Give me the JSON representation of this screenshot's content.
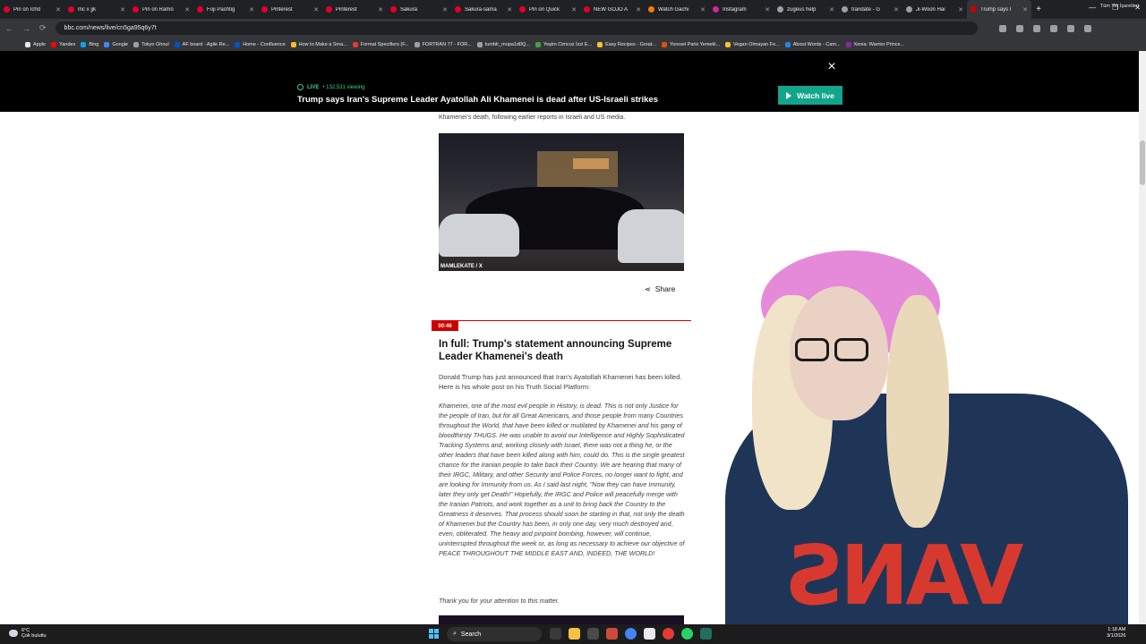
{
  "browser": {
    "tabs": [
      {
        "label": "Pin on Ichd",
        "color": "#e60023",
        "active": false
      },
      {
        "label": "mc x jjk",
        "color": "#e60023",
        "active": false
      },
      {
        "label": "Pin on Ramo",
        "color": "#e60023",
        "active": false
      },
      {
        "label": "Foji Pashtig",
        "color": "#e60023",
        "active": false
      },
      {
        "label": "Pinterest",
        "color": "#e60023",
        "active": false
      },
      {
        "label": "Pinterest",
        "color": "#e60023",
        "active": false
      },
      {
        "label": "Sakura",
        "color": "#e60023",
        "active": false
      },
      {
        "label": "Sakura-sama",
        "color": "#e60023",
        "active": false
      },
      {
        "label": "Pin on Quick",
        "color": "#e60023",
        "active": false
      },
      {
        "label": "NEW GOJO A",
        "color": "#e60023",
        "active": false
      },
      {
        "label": "Watch Gachi",
        "color": "#f57c00",
        "active": false
      },
      {
        "label": "Instagram",
        "color": "#d6249f",
        "active": false
      },
      {
        "label": "zugeus help",
        "color": "#9aa0a6",
        "active": false
      },
      {
        "label": "trandate - G",
        "color": "#9aa0a6",
        "active": false
      },
      {
        "label": "Ji-Woon Hai",
        "color": "#9aa0a6",
        "active": false
      },
      {
        "label": "Trump says I",
        "color": "#c00",
        "active": true
      }
    ],
    "new_tab": "+",
    "url": "bbc.com/news/live/cn5ga95q6y7t",
    "bookmarks": [
      {
        "label": "Apple",
        "color": "#e8eaed"
      },
      {
        "label": "Yandex",
        "color": "#ff0000"
      },
      {
        "label": "Bing",
        "color": "#00a4ef"
      },
      {
        "label": "Google",
        "color": "#4285f4"
      },
      {
        "label": "Tokyo Ghoul",
        "color": "#9aa0a6"
      },
      {
        "label": "AF board - Agile Re...",
        "color": "#0052cc"
      },
      {
        "label": "Home - Confluence",
        "color": "#0052cc"
      },
      {
        "label": "How to Make a Sma...",
        "color": "#fbc02d"
      },
      {
        "label": "Format Specifiers (F...",
        "color": "#e53935"
      },
      {
        "label": "FORTRAN 77 - FOR...",
        "color": "#9aa0a6"
      },
      {
        "label": "tumblr_mopa1d0Q...",
        "color": "#9aa0a6"
      },
      {
        "label": "Yeşim Cimcoz İzzi E...",
        "color": "#43a047"
      },
      {
        "label": "Easy Recipes - Great...",
        "color": "#fbc02d"
      },
      {
        "label": "Yoresel Paris Yemekl...",
        "color": "#e65100"
      },
      {
        "label": "Vegan Olmayan Fe...",
        "color": "#fbc02d"
      },
      {
        "label": "About Words - Cam...",
        "color": "#1e88e5"
      },
      {
        "label": "Xenia: Warrior Prince...",
        "color": "#8e24aa"
      }
    ],
    "other_bookmarks": "Tüm Yer İşaretleri"
  },
  "live_banner": {
    "close": "×",
    "live_label": "LIVE",
    "viewers": "• 132,531 viewing",
    "headline": "Trump says Iran's Supreme Leader Ayatollah Ali Khamenei is dead after US-Israeli strikes",
    "watch_button": "Watch live"
  },
  "article": {
    "prev_text": "Khamenei's death, following earlier reports in Israeli and US media.",
    "photo_credit": "MAMLEKATE / X",
    "share_label": "Share",
    "post": {
      "time": "00:46",
      "title": "In full: Trump's statement announcing Supreme Leader Khamenei's death",
      "intro": "Donald Trump has just announced that Iran's Ayatollah Khamenei has been killed. Here is his whole post on his Truth Social Platform:",
      "quote": "Khamenei, one of the most evil people in History, is dead. This is not only Justice for the people of Iran, but for all Great Americans, and those people from many Countries throughout the World, that have been killed or mutilated by Khamenei and his gang of bloodthirsty THUGS. He was unable to avoid our Intelligence and Highly Sophisticated Tracking Systems and, working closely with Israel, there was not a thing he, or the other leaders that have been killed along with him, could do. This is the single greatest chance for the Iranian people to take back their Country. We are hearing that many of their IRGC, Military, and other Security and Police Forces, no longer want to fight, and are looking for Immunity from us. As I said last night, \"Now they can have Immunity, later they only get Death!\" Hopefully, the IRGC and Police will peacefully merge with the Iranian Patriots, and work together as a unit to bring back the Country to the Greatness it deserves. That process should soon be starting in that, not only the death of Khamenei but the Country has been, in only one day, very much destroyed and, even, obliterated. The heavy and pinpoint bombing, however, will continue, uninterrupted throughout the week or, as long as necessary to achieve our objective of PEACE THROUGHOUT THE MIDDLE EAST AND, INDEED, THE WORLD!",
      "thanks": "Thank you for your attention to this matter."
    }
  },
  "streamer": {
    "hoodie_text": "VANS"
  },
  "taskbar": {
    "weather_temp": "6°C",
    "weather_desc": "Çok bulutlu",
    "search_label": "Search",
    "time": "1:18 AM",
    "date": "3/1/2026"
  }
}
